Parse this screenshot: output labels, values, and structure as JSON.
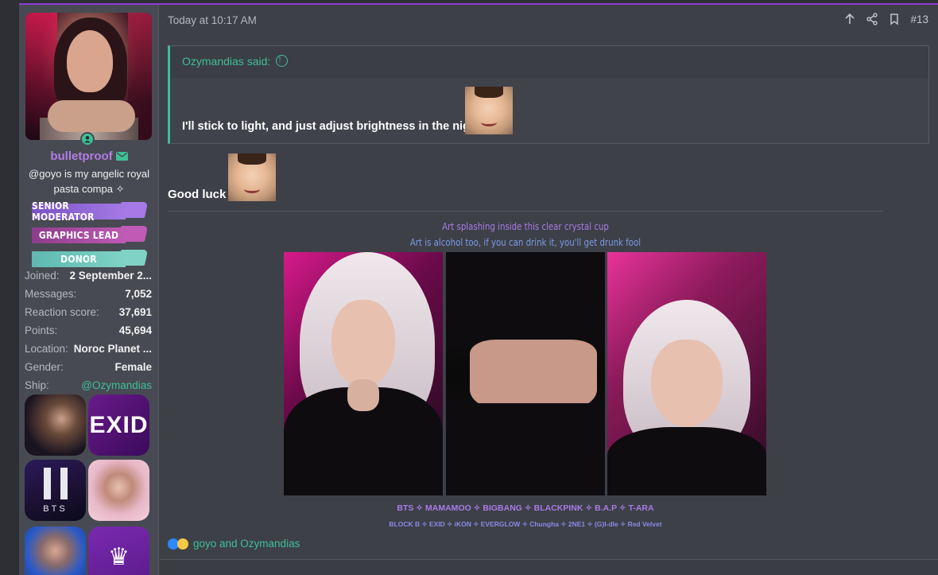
{
  "post": {
    "timestamp": "Today at 10:17 AM",
    "post_number": "#13",
    "quote": {
      "author_said": "Ozymandias said:",
      "text": "I'll stick to light, and just adjust brightness in the night"
    },
    "message": "Good luck",
    "signature": {
      "line1": "Art splashing inside this clear crystal cup",
      "line2": "Art is alcohol too, if you can drink it, you'll get drunk fool",
      "groups_line1": "BTS ✧ MAMAMOO ✧ BIGBANG ✧ BLACKPINK ✧ B.A.P ✧ T-ARA",
      "groups_line2": "BLOCK B ✧ EXID ✧ iKON ✧ EVERGLOW ✧ Chungha ✧ 2NE1 ✧ (G)I-dle ✧ Red Velvet"
    },
    "reactions": {
      "text": "goyo and Ozymandias"
    }
  },
  "user": {
    "username": "bulletproof",
    "title": "@goyo is my angelic royal pasta compa ✧",
    "banners": [
      "SENIOR MODERATOR",
      "GRAPHICS LEAD",
      "DONOR"
    ],
    "info": [
      {
        "key": "Joined:",
        "value": "2 September 2..."
      },
      {
        "key": "Messages:",
        "value": "7,052"
      },
      {
        "key": "Reaction score:",
        "value": "37,691"
      },
      {
        "key": "Points:",
        "value": "45,694"
      },
      {
        "key": "Location:",
        "value": "Noroc Planet ..."
      },
      {
        "key": "Gender:",
        "value": "Female"
      },
      {
        "key": "Ship:",
        "value": "@Ozymandias"
      }
    ],
    "badges": {
      "exid": "EXID",
      "bts": "BTS"
    }
  },
  "colors": {
    "accent_green": "#3fbf96",
    "accent_purple": "#b57ce6",
    "top_border": "#8e3dd6"
  }
}
